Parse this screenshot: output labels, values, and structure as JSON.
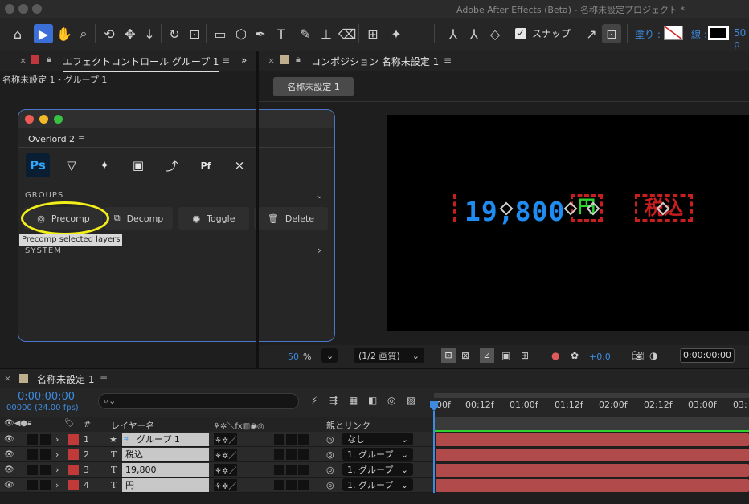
{
  "window": {
    "title": "Adobe After Effects (Beta) - 名称未設定プロジェクト *"
  },
  "toolbar": {
    "snap_label": "スナップ",
    "fill_label": "塗り :",
    "stroke_label": "線 :",
    "stroke_value": "50 p"
  },
  "left_panel": {
    "tab": "エフェクトコントロール グループ 1",
    "subtitle": "名称未設定 1・グループ 1"
  },
  "comp_panel": {
    "tab": "コンポジション 名称未設定 1",
    "comp_button": "名称未設定 1"
  },
  "overlord": {
    "title": "Overlord 2",
    "icons": [
      "Ps",
      "▽",
      "✦",
      "▣",
      "⤴",
      "Pf",
      "⨯"
    ],
    "groups_label": "GROUPS",
    "buttons": [
      "Precomp",
      "Decomp",
      "Toggle",
      "Delete"
    ],
    "tooltip": "Precomp selected layers",
    "system_label": "SYSTEM"
  },
  "canvas": {
    "price": "19,800",
    "yen": "円",
    "tax": "税込"
  },
  "viewer_bar": {
    "zoom": "50",
    "zoom_unit": "%",
    "resolution": "(1/2 画質)",
    "exposure": "+0.0",
    "timecode": "0:00:00:00"
  },
  "timeline": {
    "tab": "名称未設定 1",
    "current_time": "0:00:00:00",
    "fps": "00000 (24.00 fps)",
    "search_placeholder": "",
    "col_num": "#",
    "col_layer": "レイヤー名",
    "col_parent": "親とリンク",
    "ticks": [
      "00f",
      "00:12f",
      "01:00f",
      "01:12f",
      "02:00f",
      "02:12f",
      "03:00f",
      "03:"
    ],
    "layers": [
      {
        "num": "1",
        "type": "★",
        "name": "グループ 1",
        "parent": "なし"
      },
      {
        "num": "2",
        "type": "T",
        "name": "税込",
        "parent": "1. グループ"
      },
      {
        "num": "3",
        "type": "T",
        "name": "19,800",
        "parent": "1. グループ"
      },
      {
        "num": "4",
        "type": "T",
        "name": "円",
        "parent": "1. グループ"
      }
    ]
  },
  "colors": {
    "accent": "#3c6ed8",
    "layer_bar": "#b14a4a",
    "highlight": "#f2ee1a",
    "text_blue": "#1e8cf0",
    "text_red": "#c81e1e"
  }
}
